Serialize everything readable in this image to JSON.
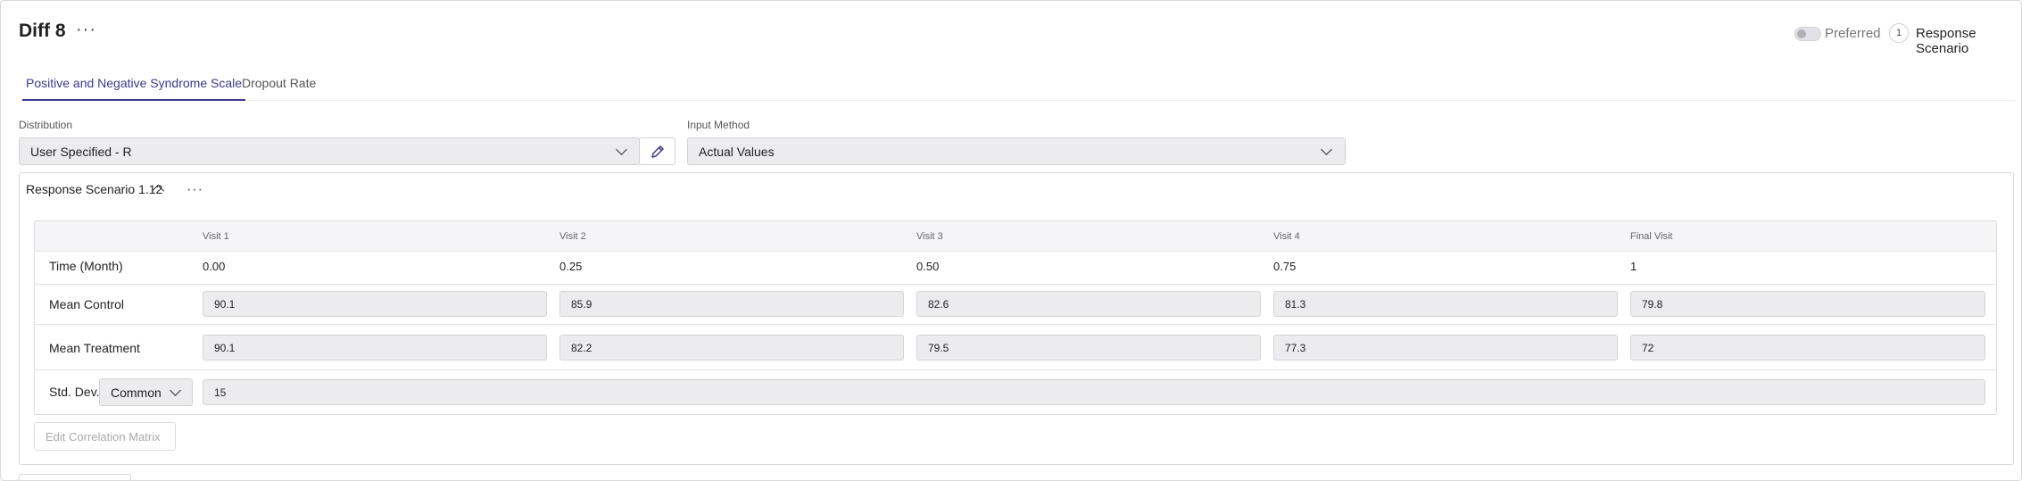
{
  "header": {
    "title": "Diff 8",
    "menu_glyph": "···",
    "preferred_label": "Preferred",
    "preferred_on": false,
    "scenario_count": "1",
    "scenario_label": "Response Scenario"
  },
  "tabs": [
    {
      "label": "Positive and Negative Syndrome Scale",
      "active": true
    },
    {
      "label": "Dropout Rate",
      "active": false
    }
  ],
  "distribution": {
    "label": "Distribution",
    "value": "User Specified - R"
  },
  "input_method": {
    "label": "Input Method",
    "value": "Actual Values"
  },
  "panel": {
    "title": "Response Scenario 1.12",
    "menu_glyph": "···",
    "columns": [
      "Visit 1",
      "Visit 2",
      "Visit 3",
      "Visit 4",
      "Final Visit"
    ],
    "rows": {
      "time": {
        "label": "Time (Month)",
        "values": [
          "0.00",
          "0.25",
          "0.50",
          "0.75",
          "1"
        ]
      },
      "mean_control": {
        "label": "Mean Control",
        "values": [
          "90.1",
          "85.9",
          "82.6",
          "81.3",
          "79.8"
        ]
      },
      "mean_treatment": {
        "label": "Mean Treatment",
        "values": [
          "90.1",
          "82.2",
          "79.5",
          "77.3",
          "72"
        ]
      },
      "std_dev": {
        "label": "Std. Dev.",
        "type": "Common",
        "value": "15"
      }
    },
    "edit_correlation_label": "Edit Correlation Matrix"
  },
  "colors": {
    "accent": "#3c3a8c",
    "field_bg": "#ececef",
    "border": "#d9d9dd"
  }
}
